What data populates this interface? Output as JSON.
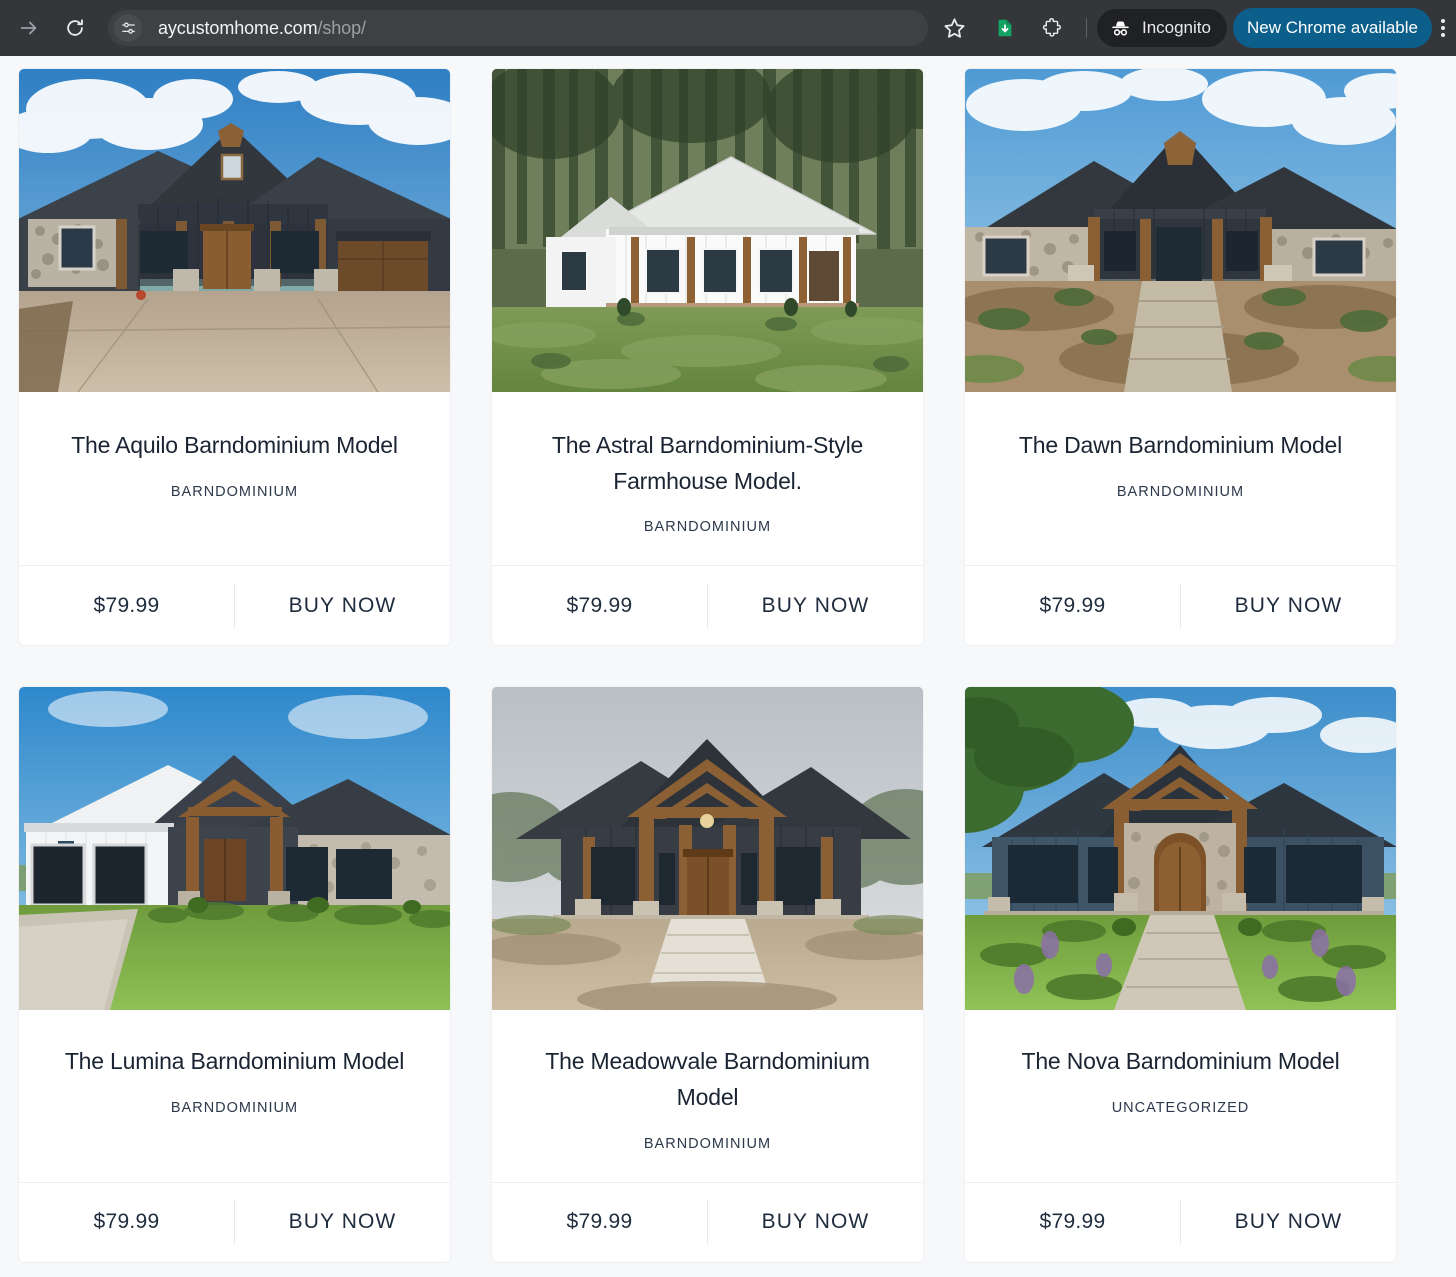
{
  "browser": {
    "forward_icon": "arrow-forward-icon",
    "reload_icon": "reload-icon",
    "site_settings_icon": "tune-sliders-icon",
    "url_host": "aycustomhome.com",
    "url_path": "/shop/",
    "bookmark_icon": "star-icon",
    "download_icon": "download-complete-icon",
    "extensions_icon": "puzzle-piece-icon",
    "incognito_icon": "incognito-spy-icon",
    "incognito_label": "Incognito",
    "update_label": "New Chrome available",
    "menu_icon": "kebab-menu-icon",
    "toolbar_bg": "#35363a",
    "omnibox_bg": "#3f4042",
    "update_bg": "#0b5f8a"
  },
  "shop": {
    "background": "#f7f8fa",
    "card_bg": "#ffffff",
    "products": [
      {
        "title": "The Aquilo Barndominium Model",
        "category": "BARNDOMINIUM",
        "price": "$79.99",
        "buy_label": "BUY NOW",
        "image_alt": "dark-metal-roof-stone-barndominium-with-concrete-driveway"
      },
      {
        "title": "The Astral Barndominium-Style Farmhouse Model.",
        "category": "BARNDOMINIUM",
        "price": "$79.99",
        "buy_label": "BUY NOW",
        "image_alt": "white-farmhouse-barndominium-in-pine-forest-clearing"
      },
      {
        "title": "The Dawn Barndominium Model",
        "category": "BARNDOMINIUM",
        "price": "$79.99",
        "buy_label": "BUY NOW",
        "image_alt": "stone-and-timber-barndominium-with-gravel-landscaping"
      },
      {
        "title": "The Lumina Barndominium Model",
        "category": "BARNDOMINIUM",
        "price": "$79.99",
        "buy_label": "BUY NOW",
        "image_alt": "white-and-stone-barndominium-with-two-car-garage-and-green-lawn"
      },
      {
        "title": "The Meadowvale Barndominium Model",
        "category": "BARNDOMINIUM",
        "price": "$79.99",
        "buy_label": "BUY NOW",
        "image_alt": "dark-barndominium-with-heavy-timber-porch-and-dirt-yard"
      },
      {
        "title": "The Nova Barndominium Model",
        "category": "UNCATEGORIZED",
        "price": "$79.99",
        "buy_label": "BUY NOW",
        "image_alt": "blue-barndominium-with-arched-stone-entry-and-oak-tree"
      }
    ]
  }
}
